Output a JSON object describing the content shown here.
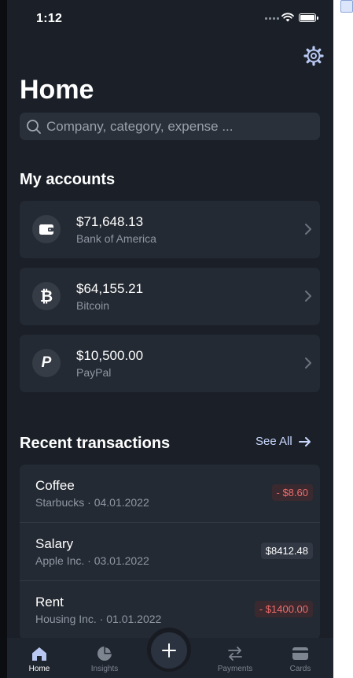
{
  "status": {
    "time": "1:12"
  },
  "page": {
    "title": "Home"
  },
  "search": {
    "placeholder": "Company, category, expense ..."
  },
  "accounts": {
    "title": "My accounts",
    "items": [
      {
        "amount": "$71,648.13",
        "name": "Bank of America",
        "icon": "wallet-icon"
      },
      {
        "amount": "$64,155.21",
        "name": "Bitcoin",
        "icon": "bitcoin-icon"
      },
      {
        "amount": "$10,500.00",
        "name": "PayPal",
        "icon": "paypal-icon"
      }
    ]
  },
  "transactions": {
    "title": "Recent transactions",
    "see_all": "See All",
    "items": [
      {
        "title": "Coffee",
        "subtitle": "Starbucks · 04.01.2022",
        "amount": "- $8.60",
        "type": "expense"
      },
      {
        "title": "Salary",
        "subtitle": "Apple Inc. · 03.01.2022",
        "amount": "$8412.48",
        "type": "income"
      },
      {
        "title": "Rent",
        "subtitle": "Housing Inc. · 01.01.2022",
        "amount": "- $1400.00",
        "type": "expense"
      }
    ]
  },
  "tabs": [
    {
      "label": "Home",
      "icon": "home-icon",
      "active": true
    },
    {
      "label": "Insights",
      "icon": "pie-chart-icon",
      "active": false
    },
    {
      "label": "Payments",
      "icon": "transfer-icon",
      "active": false
    },
    {
      "label": "Cards",
      "icon": "card-icon",
      "active": false
    }
  ],
  "colors": {
    "background": "#1b2028",
    "card": "#242a33",
    "accent": "#c9d8ff",
    "expense": "#ee6c6c"
  }
}
